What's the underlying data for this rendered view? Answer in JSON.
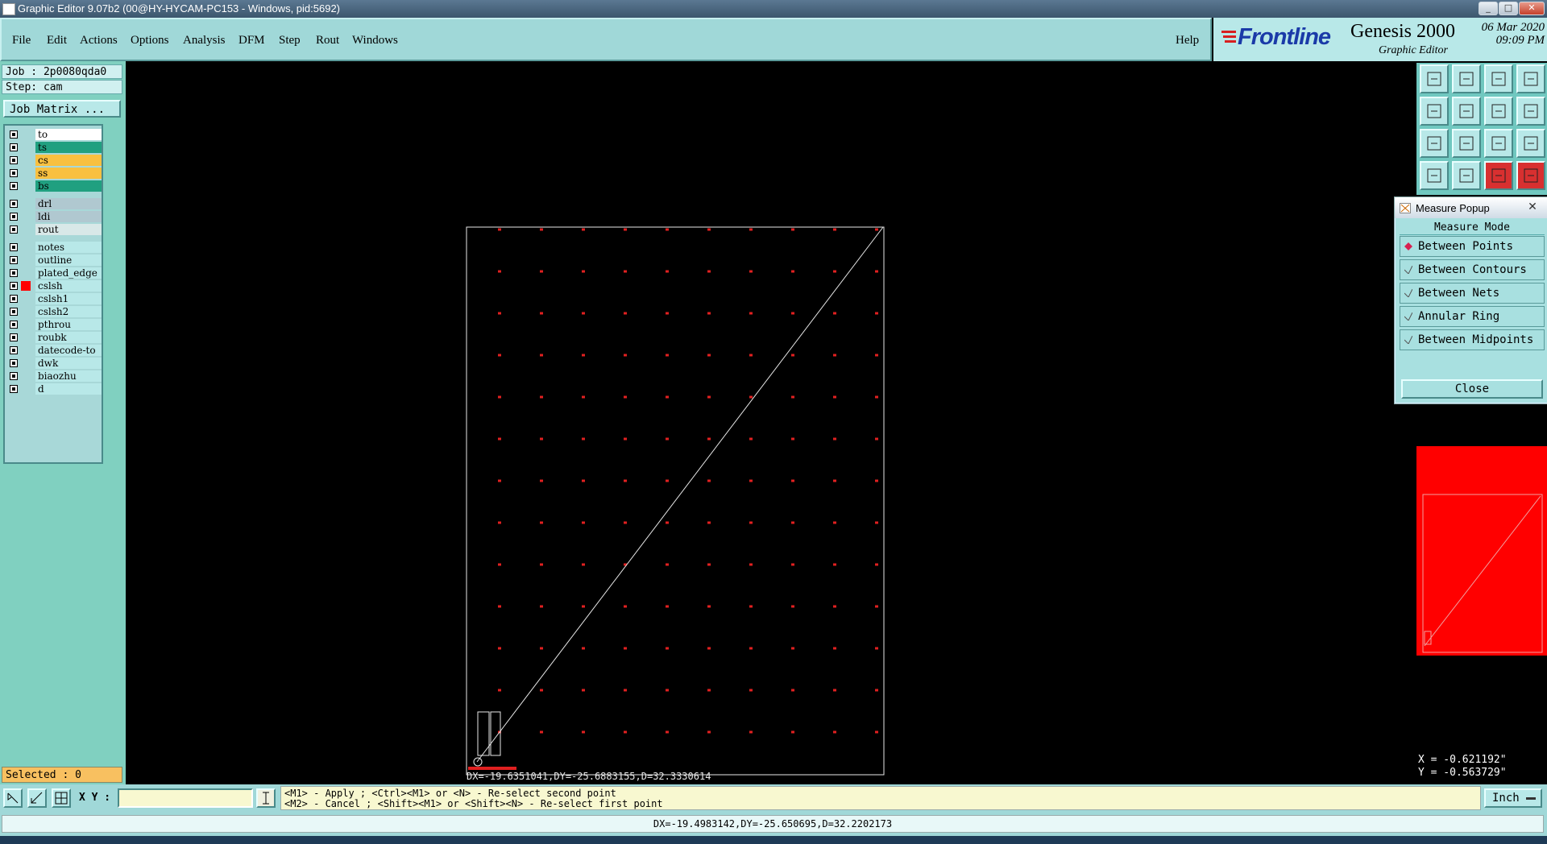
{
  "window": {
    "title": "Graphic Editor 9.07b2 (00@HY-HYCAM-PC153 - Windows, pid:5692)",
    "minimize": "_",
    "maximize": "□",
    "close": "✕"
  },
  "menu": {
    "items": [
      {
        "label": "File",
        "key": "F"
      },
      {
        "label": "Edit",
        "key": "E"
      },
      {
        "label": "Actions",
        "key": "A"
      },
      {
        "label": "Options",
        "key": "O"
      },
      {
        "label": "Analysis",
        "key": "A"
      },
      {
        "label": "DFM",
        "key": "D"
      },
      {
        "label": "Step",
        "key": "S"
      },
      {
        "label": "Rout",
        "key": "R"
      },
      {
        "label": "Windows",
        "key": "W"
      }
    ],
    "help": "Help"
  },
  "brand": {
    "logo": "Frontline",
    "product": "Genesis 2000",
    "subtitle": "Graphic Editor",
    "date": "06 Mar 2020",
    "time": "09:09 PM",
    "logo_color": "#1a3aa8"
  },
  "job": {
    "job_label": "Job : 2p0080qda0",
    "step_label": "Step: cam",
    "matrix_button": "Job Matrix ..."
  },
  "layers": [
    {
      "name": "to",
      "color": "#ffffff",
      "mark": ""
    },
    {
      "name": "ts",
      "color": "#20a080",
      "mark": ""
    },
    {
      "name": "cs",
      "color": "#f8c040",
      "mark": ""
    },
    {
      "name": "ss",
      "color": "#f8c040",
      "mark": ""
    },
    {
      "name": "bs",
      "color": "#20a080",
      "mark": ""
    },
    {
      "name": "drl",
      "color": "#b0c8d0",
      "mark": ""
    },
    {
      "name": "ldi",
      "color": "#b0c8d0",
      "mark": ""
    },
    {
      "name": "rout",
      "color": "#d8e8e8",
      "mark": ""
    },
    {
      "name": "notes",
      "color": "#b8e8e8",
      "mark": ""
    },
    {
      "name": "outline",
      "color": "#b8e8e8",
      "mark": ""
    },
    {
      "name": "plated_edge",
      "color": "#b8e8e8",
      "mark": ""
    },
    {
      "name": "cslsh",
      "color": "#b8e8e8",
      "mark": "red"
    },
    {
      "name": "cslsh1",
      "color": "#b8e8e8",
      "mark": ""
    },
    {
      "name": "cslsh2",
      "color": "#b8e8e8",
      "mark": ""
    },
    {
      "name": "pthrou",
      "color": "#b8e8e8",
      "mark": ""
    },
    {
      "name": "roubk",
      "color": "#b8e8e8",
      "mark": ""
    },
    {
      "name": "datecode-to",
      "color": "#b8e8e8",
      "mark": ""
    },
    {
      "name": "dwk",
      "color": "#b8e8e8",
      "mark": ""
    },
    {
      "name": "biaozhu",
      "color": "#b8e8e8",
      "mark": ""
    },
    {
      "name": "d",
      "color": "#b8e8e8",
      "mark": ""
    }
  ],
  "selected": "Selected : 0",
  "canvas": {
    "overlay_text": "DX=-19.6351041,DY=-25.6883155,D=32.3330614",
    "pad_color": "#e02020"
  },
  "measure_popup": {
    "title": "Measure Popup",
    "heading": "Measure Mode",
    "options": [
      "Between Points",
      "Between Contours",
      "Between Nets",
      "Annular Ring",
      "Between Midpoints"
    ],
    "selected_option": "Between Points",
    "close_label": "Close"
  },
  "toolbar": {
    "icons": [
      "zoom-home-icon",
      "zoom-out-icon",
      "home-icon",
      "layout-icon",
      "pan-left-icon",
      "pan-right-icon",
      "undo-view-icon",
      "redraw-icon",
      "fit-icon",
      "fit-profile-icon",
      "one-to-one-icon",
      "help-icon",
      "pen-icon",
      "grid-icon",
      "snap-icon",
      "measure-icon"
    ]
  },
  "coords": {
    "x": "X = -0.621192\"",
    "y": "Y = -0.563729\""
  },
  "input": {
    "xy_label": "X Y :",
    "xy_value": ""
  },
  "prompt": {
    "line1": "<M1> - Apply  ; <Ctrl><M1> or <N> - Re-select second point",
    "line2": "<M2> - Cancel ; <Shift><M1> or <Shift><N> - Re-select first point"
  },
  "unit": "Inch",
  "message": "DX=-19.4983142,DY=-25.650695,D=32.2202173"
}
